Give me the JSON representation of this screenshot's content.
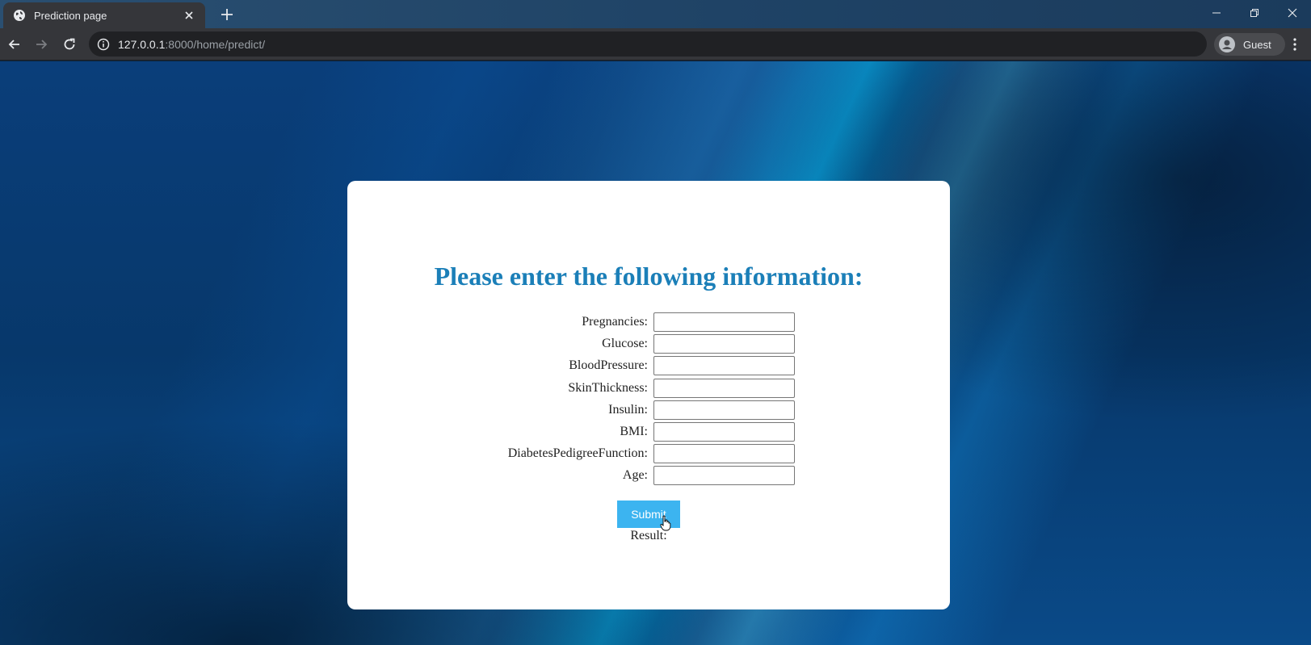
{
  "browser": {
    "tab_title": "Prediction page",
    "url_host": "127.0.0.1",
    "url_rest": ":8000/home/predict/",
    "profile_label": "Guest"
  },
  "page": {
    "heading": "Please enter the following information:",
    "fields": [
      {
        "label": "Pregnancies:",
        "value": ""
      },
      {
        "label": "Glucose:",
        "value": ""
      },
      {
        "label": "BloodPressure:",
        "value": ""
      },
      {
        "label": "SkinThickness:",
        "value": ""
      },
      {
        "label": "Insulin:",
        "value": ""
      },
      {
        "label": "BMI:",
        "value": ""
      },
      {
        "label": "DiabetesPedigreeFunction:",
        "value": ""
      },
      {
        "label": "Age:",
        "value": ""
      }
    ],
    "submit_label": "Submit",
    "result_label": "Result:"
  },
  "colors": {
    "heading": "#1b7fb8",
    "submit_bg": "#3cb4f0",
    "tab_bg": "#35363a"
  },
  "icons": {
    "tab": "globe-icon",
    "tab_close": "close-icon",
    "new_tab": "plus-icon",
    "back": "back-arrow-icon",
    "forward": "forward-arrow-icon",
    "reload": "reload-icon",
    "site_info": "info-icon",
    "profile": "avatar-icon",
    "menu": "kebab-menu-icon"
  }
}
